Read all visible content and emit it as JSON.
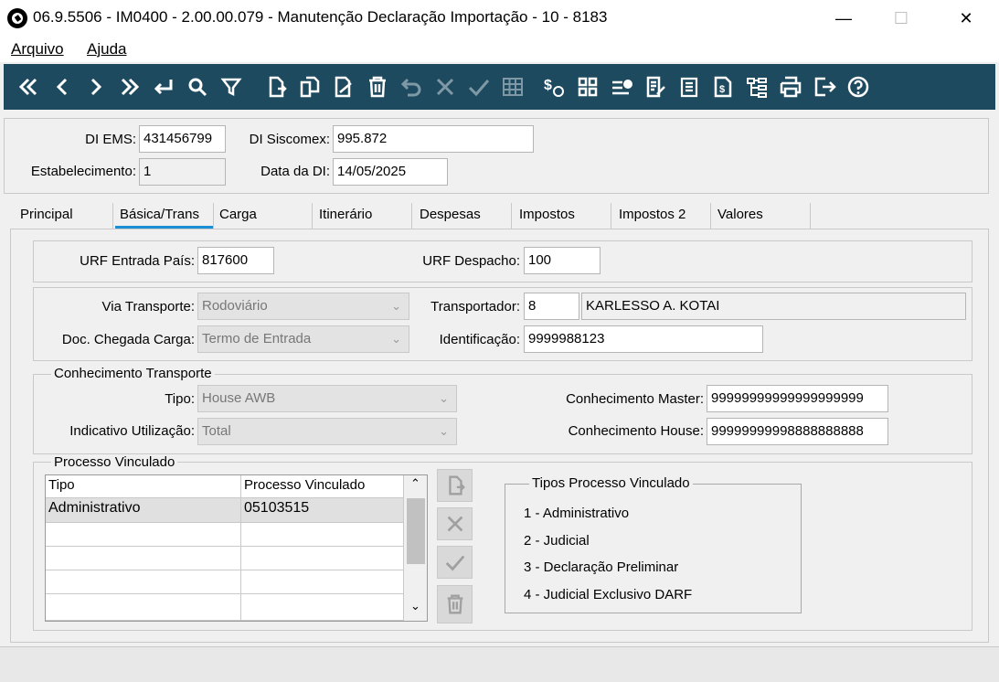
{
  "window": {
    "title": "06.9.5506 - IM0400 - 2.00.00.079 - Manutenção Declaração Importação - 10 - 8183",
    "minimize": "—",
    "maximize": "☐",
    "close": "✕"
  },
  "menu": {
    "arquivo": "Arquivo",
    "ajuda": "Ajuda"
  },
  "toolbar": {
    "icons": [
      "first-icon",
      "prev-icon",
      "next-icon",
      "last-icon",
      "goto-icon",
      "search-icon",
      "filter-icon",
      "new-icon",
      "copy-icon",
      "edit-icon",
      "delete-icon",
      "undo-icon",
      "cancel-icon",
      "confirm-icon",
      "grid-icon",
      "money-icon",
      "apps-icon",
      "list-alert-icon",
      "doc-edit-icon",
      "doc-icon",
      "doc-money-icon",
      "tree-icon",
      "print-icon",
      "exit-icon",
      "help-icon"
    ],
    "colors": {
      "background": "#1e4a5f",
      "icon": "#ffffff",
      "disabled": "#7f98a5"
    }
  },
  "header": {
    "di_ems_label": "DI EMS:",
    "di_ems_value": "431456799",
    "di_siscomex_label": "DI Siscomex:",
    "di_siscomex_value": "995.872",
    "estabelecimento_label": "Estabelecimento:",
    "estabelecimento_value": "1",
    "data_di_label": "Data da DI:",
    "data_di_value": "14/05/2025"
  },
  "tabs": [
    "Principal",
    "Básica/Trans",
    "Carga",
    "Itinerário",
    "Despesas",
    "Impostos",
    "Impostos 2",
    "Valores"
  ],
  "active_tab": "Básica/Trans",
  "accent_color": "#1a8fd6",
  "urf": {
    "entrada_label": "URF Entrada País:",
    "entrada_value": "817600",
    "despacho_label": "URF Despacho:",
    "despacho_value": "100"
  },
  "transporte": {
    "via_label": "Via Transporte:",
    "via_value": "Rodoviário",
    "doc_label": "Doc. Chegada Carga:",
    "doc_value": "Termo de Entrada",
    "transportador_label": "Transportador:",
    "transportador_code": "8",
    "transportador_name": "KARLESSO A. KOTAI",
    "identificacao_label": "Identificação:",
    "identificacao_value": "9999988123"
  },
  "conhecimento": {
    "title": "Conhecimento Transporte",
    "tipo_label": "Tipo:",
    "tipo_value": "House AWB",
    "indicativo_label": "Indicativo Utilização:",
    "indicativo_value": "Total",
    "master_label": "Conhecimento Master:",
    "master_value": "99999999999999999999",
    "house_label": "Conhecimento House:",
    "house_value": "99999999998888888888"
  },
  "processo": {
    "title": "Processo Vinculado",
    "columns": [
      "Tipo",
      "Processo Vinculado"
    ],
    "rows": [
      [
        "Administrativo",
        "05103515"
      ]
    ],
    "tipos_title": "Tipos Processo Vinculado",
    "tipos": [
      "1 - Administrativo",
      "2 - Judicial",
      "3 - Declaração Preliminar",
      "4 - Judicial Exclusivo DARF"
    ]
  }
}
